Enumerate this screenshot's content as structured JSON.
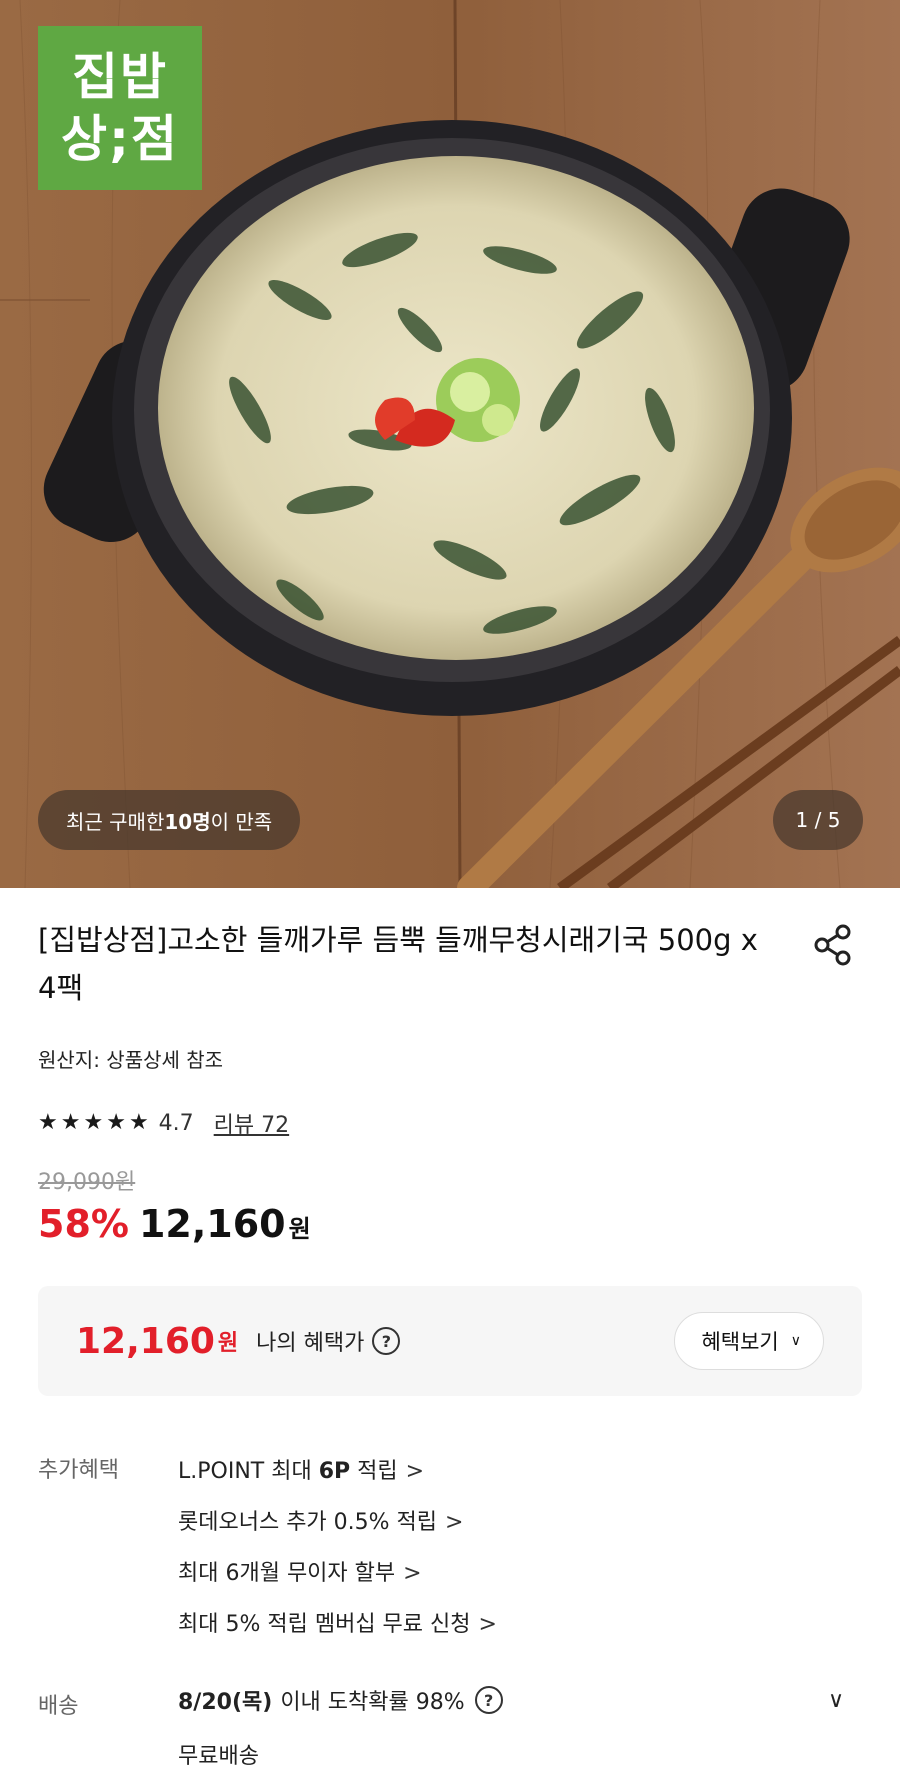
{
  "hero": {
    "logo_line1": "집밥",
    "logo_line2": "상;점",
    "buyers_prefix": "최근 구매한 ",
    "buyers_count": "10명",
    "buyers_suffix": "이 만족",
    "page_indicator": "1 / 5"
  },
  "product": {
    "title": "[집밥상점]고소한 들깨가루 듬뿍 들깨무청시래기국 500g x 4팩",
    "origin": "원산지: 상품상세 참조",
    "rating_score": "4.7",
    "rating_stars": 4.7,
    "review_label": "리뷰 72",
    "original_price": "29,090원",
    "discount_pct": "58%",
    "sale_price": "12,160",
    "currency": "원"
  },
  "benefit": {
    "price": "12,160",
    "currency": "원",
    "label": "나의 혜택가",
    "help": "?",
    "button_label": "혜택보기",
    "button_chevron": "∨"
  },
  "extra": {
    "label": "추가혜택",
    "items": [
      {
        "pre": "L.POINT 최대 ",
        "bold": "6P",
        "post": " 적립",
        "arrow": ">"
      },
      {
        "pre": "롯데오너스 추가 0.5% 적립",
        "bold": "",
        "post": "",
        "arrow": ">"
      },
      {
        "pre": "최대 6개월 무이자 할부",
        "bold": "",
        "post": "",
        "arrow": ">"
      },
      {
        "pre": "최대 5% 적립 멤버십 무료 신청",
        "bold": "",
        "post": "",
        "arrow": ">"
      }
    ]
  },
  "shipping": {
    "label": "배송",
    "date": "8/20(목)",
    "desc": "이내 도착확률 98%",
    "help": "?",
    "chevron": "∨",
    "free": "무료배송"
  },
  "colors": {
    "accent_red": "#e21f2a",
    "logo_green": "#5fa843"
  }
}
